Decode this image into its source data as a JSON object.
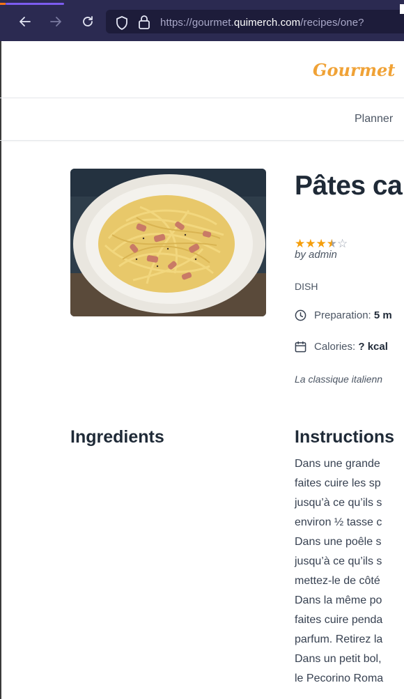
{
  "browser": {
    "url_prefix": "https://gourmet.",
    "url_host": "quimerch.com",
    "url_path": "/recipes/one?",
    "icons": [
      "arrow-left-icon",
      "arrow-right-icon",
      "reload-icon",
      "shield-icon",
      "lock-icon"
    ],
    "chrome_color": "#2b2a51"
  },
  "header": {
    "brand": "Gourmet",
    "brand_color": "#f0a236"
  },
  "nav": {
    "items": [
      {
        "label": "Planner"
      }
    ]
  },
  "recipe": {
    "image_alt": "spaghetti carbonara",
    "title": "Pâtes ca",
    "rating": {
      "value": 3.5,
      "max": 5
    },
    "author": "by admin",
    "category": "DISH",
    "preparation_label": "Preparation:",
    "preparation_value": "5 m",
    "calories_label": "Calories:",
    "calories_value": "? kcal",
    "description": "La classique italienn"
  },
  "sections": {
    "ingredients_heading": "Ingredients",
    "instructions_heading": "Instructions",
    "instructions_lines": [
      "Dans une grande",
      "faites cuire les sp",
      "jusqu’à ce qu’ils s",
      "environ ½ tasse c",
      "Dans une poêle s",
      "jusqu’à ce qu’ils s",
      "mettez-le de côté",
      "Dans la même po",
      "faites cuire penda",
      "parfum. Retirez la",
      "Dans un petit bol,",
      "le Pecorino Roma"
    ]
  }
}
